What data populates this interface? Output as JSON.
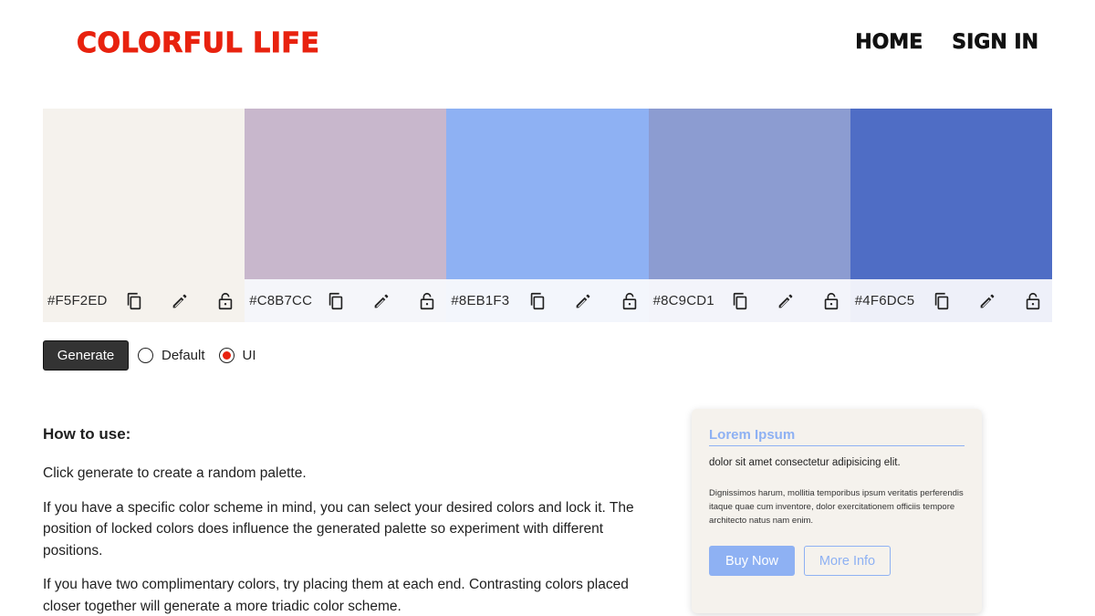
{
  "header": {
    "logo": "COLORFUL LIFE",
    "nav": [
      "HOME",
      "SIGN IN"
    ]
  },
  "palette": {
    "colors": [
      {
        "hex_label": "#F5F2ED",
        "color": "#F5F2ED",
        "bar_bg": "#F5F2ED"
      },
      {
        "hex_label": "#C8B7CC",
        "color": "#C8B7CC",
        "bar_bg": "#F5F6FA"
      },
      {
        "hex_label": "#8EB1F3",
        "color": "#8EB1F3",
        "bar_bg": "#F3F6FC"
      },
      {
        "hex_label": "#8C9CD1",
        "color": "#8C9CD1",
        "bar_bg": "#F3F4FA"
      },
      {
        "hex_label": "#4F6DC5",
        "color": "#4F6DC5",
        "bar_bg": "#EEF0F9"
      }
    ],
    "icons": [
      "copy-icon",
      "edit-icon",
      "lock-icon"
    ]
  },
  "controls": {
    "generate_label": "Generate",
    "mode_options": [
      "Default",
      "UI"
    ],
    "selected_mode": "UI"
  },
  "howto": {
    "heading": "How to use:",
    "paragraphs": [
      "Click generate to create a random palette.",
      "If you have a specific color scheme in mind, you can select your desired colors and lock it. The position of locked colors does influence the generated palette so experiment with different positions.",
      "If you have two complimentary colors, try placing them at each end. Contrasting colors placed closer together will generate a more triadic color scheme."
    ]
  },
  "preview_card": {
    "title": "Lorem Ipsum",
    "subtitle": "dolor sit amet consectetur adipisicing elit.",
    "body": "Dignissimos harum, mollitia temporibus ipsum veritatis perferendis itaque quae cum inventore, dolor exercitationem officiis tempore architecto natus nam enim.",
    "buy_label": "Buy Now",
    "info_label": "More Info"
  },
  "colors": {
    "brand": "#E8220F",
    "button_dark": "#333333",
    "accent": "#8EB1F3"
  }
}
